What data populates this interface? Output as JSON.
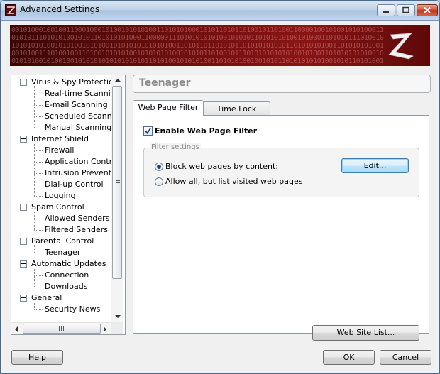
{
  "window": {
    "title": "Advanced Settings",
    "accent": "#8a1414"
  },
  "banner": {
    "binary_lines": [
      "00101000100100110001000101001010101001101010100010101101011010010110100110000100101001010100011",
      "01010111010101001010110101010100011000001110101010101001010101101010101001010001101010111010010",
      "10101010100101010010101001010101010101010011010110110101011010101010101101010101001101010101001",
      "00101001110100100110100101010100101010101001010101101001011101010101010100101001101010101010010",
      "01010100101001001010101010101010101101010010101010011010101001001010110101010101001010110101001"
    ]
  },
  "tree": {
    "items": [
      {
        "label": "Virus & Spy Protection",
        "level": 0
      },
      {
        "label": "Real-time Scanning",
        "level": 1
      },
      {
        "label": "E-mail Scanning",
        "level": 1
      },
      {
        "label": "Scheduled Scanning",
        "level": 1
      },
      {
        "label": "Manual Scanning",
        "level": 1
      },
      {
        "label": "Internet Shield",
        "level": 0
      },
      {
        "label": "Firewall",
        "level": 1
      },
      {
        "label": "Application Control",
        "level": 1
      },
      {
        "label": "Intrusion Prevention",
        "level": 1
      },
      {
        "label": "Dial-up Control",
        "level": 1
      },
      {
        "label": "Logging",
        "level": 1
      },
      {
        "label": "Spam Control",
        "level": 0
      },
      {
        "label": "Allowed Senders",
        "level": 1
      },
      {
        "label": "Filtered Senders",
        "level": 1
      },
      {
        "label": "Parental Control",
        "level": 0
      },
      {
        "label": "Teenager",
        "level": 1
      },
      {
        "label": "Automatic Updates",
        "level": 0
      },
      {
        "label": "Connection",
        "level": 1
      },
      {
        "label": "Downloads",
        "level": 1
      },
      {
        "label": "General",
        "level": 0
      },
      {
        "label": "Security News",
        "level": 1
      }
    ]
  },
  "page": {
    "title": "Teenager",
    "tabs": [
      {
        "label": "Web Page Filter",
        "active": true
      },
      {
        "label": "Time Lock",
        "active": false
      }
    ],
    "enable_filter": {
      "label": "Enable Web Page Filter",
      "checked": true
    },
    "group": {
      "label": "Filter settings",
      "option_block": "Block web pages by content:",
      "option_allow": "Allow all, but list visited web pages",
      "edit_button": "Edit..."
    },
    "site_list_button": "Web Site List..."
  },
  "footer": {
    "help": "Help",
    "ok": "OK",
    "cancel": "Cancel"
  }
}
